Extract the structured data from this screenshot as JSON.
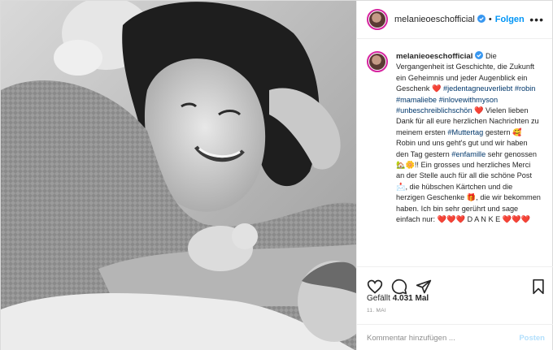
{
  "colors": {
    "link": "#0095f6",
    "tag": "#00376b",
    "heart": "#e0245e",
    "muted": "#8e8e8e"
  },
  "header": {
    "username": "melanieoeschofficial",
    "separator": "•",
    "follow_label": "Folgen",
    "more_icon": "more-horizontal-icon"
  },
  "photo": {
    "description_icon": "post-photo"
  },
  "caption": {
    "username": "melanieoeschofficial",
    "part1": "Die Vergangenheit ist Geschichte, die Zukunft ein Geheimnis und jeder Augenblick ein Geschenk",
    "heart1": "❤️",
    "tag1": "#jedentagneuverliebt",
    "tag2": "#robin",
    "tag3": "#mamaliebe",
    "tag4": "#inlovewithmyson",
    "tag5": "#unbeschreiblichschön",
    "heart2": "❤️",
    "part2": "Vielen lieben Dank für all eure herzlichen Nachrichten zu meinem ersten",
    "tag6": "#Muttertag",
    "part3": "gestern 🥰 Robin und uns geht's gut und wir haben den Tag gestern",
    "tag7": "#enfamille",
    "part4": "sehr genossen 🏡🌼!! Ein grosses und herzliches Merci an der Stelle auch für all die schöne Post 📩, die hübschen Kärtchen und die herzigen Geschenke 🎁, die wir bekommen haben. Ich bin sehr gerührt und sage einfach nur:",
    "part5": "❤️❤️❤️ D A N K E ❤️❤️❤️"
  },
  "actions": {
    "like_icon": "heart-icon",
    "comment_icon": "comment-icon",
    "share_icon": "share-icon",
    "save_icon": "bookmark-icon"
  },
  "likes": {
    "prefix": "Gefällt",
    "count": "4.031 Mal"
  },
  "date": "11. MAI",
  "comment": {
    "placeholder": "Kommentar hinzufügen ...",
    "post_label": "Posten"
  }
}
